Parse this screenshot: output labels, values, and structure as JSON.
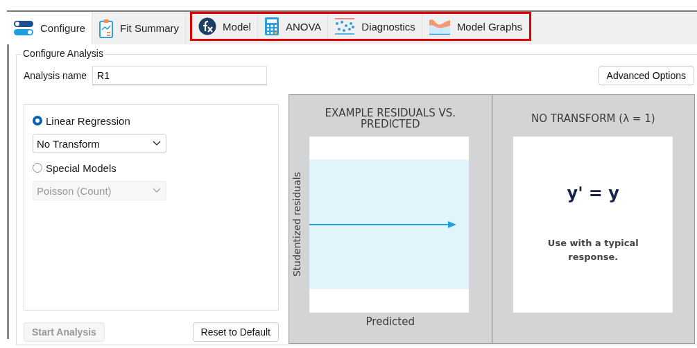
{
  "tabs": [
    {
      "label": "Configure",
      "selected": true,
      "highlighted": false
    },
    {
      "label": "Fit Summary",
      "selected": false,
      "highlighted": false
    },
    {
      "label": "Model",
      "selected": false,
      "highlighted": true
    },
    {
      "label": "ANOVA",
      "selected": false,
      "highlighted": true
    },
    {
      "label": "Diagnostics",
      "selected": false,
      "highlighted": true
    },
    {
      "label": "Model Graphs",
      "selected": false,
      "highlighted": true
    }
  ],
  "group_title": "Configure Analysis",
  "analysis_name": {
    "label": "Analysis name",
    "value": "R1"
  },
  "advanced_button": "Advanced Options",
  "options": [
    {
      "label": "Linear Regression",
      "selected": true,
      "dropdown": {
        "value": "No Transform",
        "disabled": false
      }
    },
    {
      "label": "Special Models",
      "selected": false,
      "dropdown": {
        "value": "Poisson (Count)",
        "disabled": true
      }
    }
  ],
  "buttons": [
    {
      "label": "Start Analysis",
      "disabled": true
    },
    {
      "label": "Reset to Default",
      "disabled": false
    }
  ],
  "illustration": {
    "plot_title": "EXAMPLE RESIDUALS VS. PREDICTED",
    "ylabel": "Studentized residuals",
    "xlabel": "Predicted",
    "transform_title": "NO TRANSFORM (λ = 1)",
    "formula": "y' = y",
    "note": "Use with a typical response."
  }
}
